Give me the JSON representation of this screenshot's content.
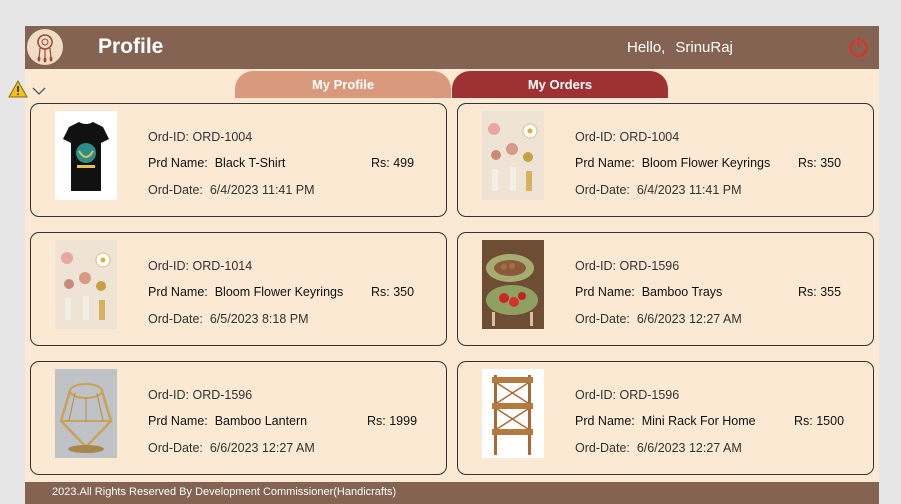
{
  "header": {
    "title": "Profile",
    "greeting": "Hello,",
    "user": "SrinuRaj"
  },
  "tabs": [
    {
      "label": "My Profile",
      "active": false
    },
    {
      "label": "My Orders",
      "active": true
    }
  ],
  "orders": [
    {
      "ord_id_label": "Ord-ID:",
      "ord_id": "ORD-1004",
      "prd_label": "Prd Name:",
      "prd_name": "Black T-Shirt",
      "price": "Rs: 499",
      "date_label": "Ord-Date:",
      "date": "6/4/2023 11:41 PM"
    },
    {
      "ord_id_label": "Ord-ID:",
      "ord_id": "ORD-1004",
      "prd_label": "Prd Name:",
      "prd_name": "Bloom Flower Keyrings",
      "price": "Rs: 350",
      "date_label": "Ord-Date:",
      "date": "6/4/2023 11:41 PM"
    },
    {
      "ord_id_label": "Ord-ID:",
      "ord_id": "ORD-1014",
      "prd_label": "Prd Name:",
      "prd_name": "Bloom Flower Keyrings",
      "price": "Rs: 350",
      "date_label": "Ord-Date:",
      "date": "6/5/2023 8:18 PM"
    },
    {
      "ord_id_label": "Ord-ID:",
      "ord_id": "ORD-1596",
      "prd_label": "Prd Name:",
      "prd_name": "Bamboo Trays",
      "price": "Rs: 355",
      "date_label": "Ord-Date:",
      "date": "6/6/2023 12:27 AM"
    },
    {
      "ord_id_label": "Ord-ID:",
      "ord_id": "ORD-1596",
      "prd_label": "Prd Name:",
      "prd_name": "Bamboo Lantern",
      "price": "Rs: 1999",
      "date_label": "Ord-Date:",
      "date": "6/6/2023 12:27 AM"
    },
    {
      "ord_id_label": "Ord-ID:",
      "ord_id": "ORD-1596",
      "prd_label": "Prd Name:",
      "prd_name": "Mini Rack For Home",
      "price": "Rs: 1500",
      "date_label": "Ord-Date:",
      "date": "6/6/2023 12:27 AM"
    }
  ],
  "footer": {
    "text": "2023.All Rights Reserved By Development Commissioner(Handicrafts)"
  },
  "colors": {
    "header": "#846352",
    "background": "#fbe9d3",
    "tab_profile": "#d9997c",
    "tab_orders": "#9e3232",
    "power": "#d62b2b"
  }
}
